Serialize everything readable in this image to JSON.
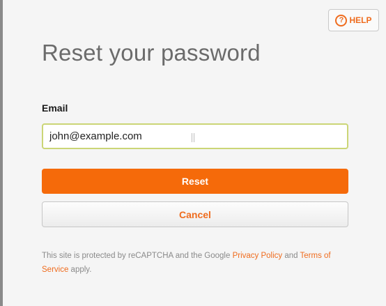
{
  "help": {
    "label": "HELP",
    "icon_glyph": "?"
  },
  "title": "Reset your password",
  "form": {
    "email_label": "Email",
    "email_value": "john@example.com",
    "reset_label": "Reset",
    "cancel_label": "Cancel"
  },
  "recaptcha": {
    "text_before": "This site is protected by reCAPTCHA and the Google ",
    "privacy_link": "Privacy Policy",
    "text_middle": " and ",
    "terms_link": "Terms of Service",
    "text_after": " apply."
  },
  "colors": {
    "accent": "#f56a0a",
    "link": "#ef6c1e",
    "input_focus_border": "#cbd576"
  }
}
